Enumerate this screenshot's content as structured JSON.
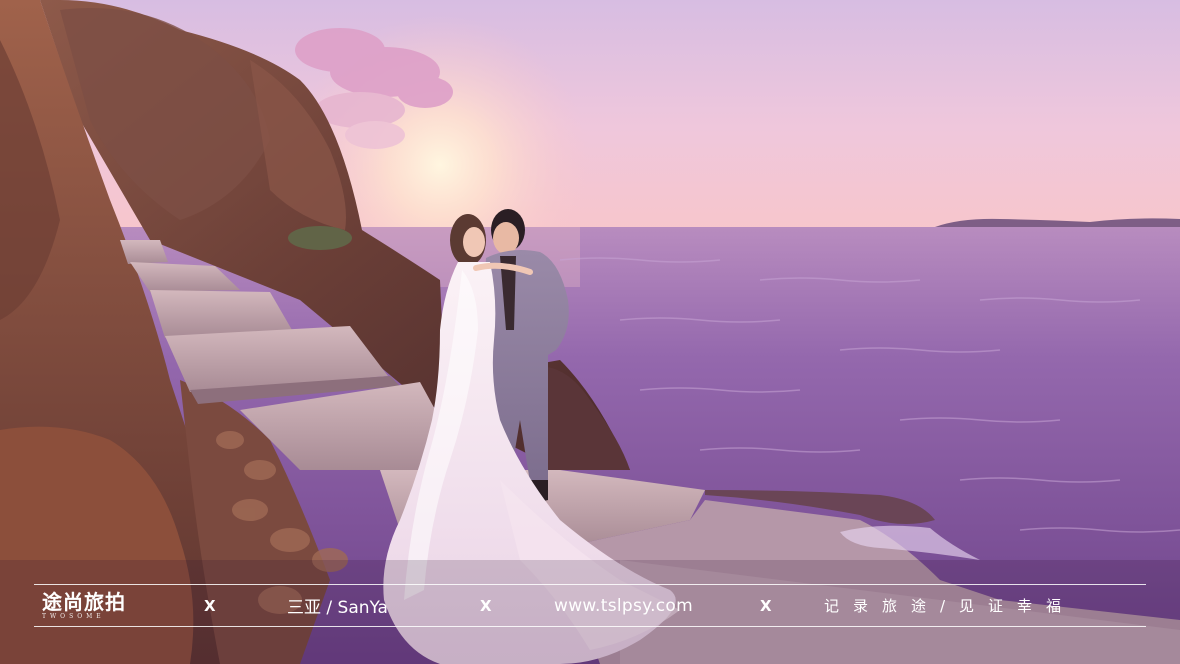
{
  "photo": {
    "subject": "wedding-couple-on-seaside-rocks-at-sunset",
    "colors": {
      "sky_top": "#e2c6e6",
      "sky_horizon": "#f4c2cc",
      "sun": "#fff2d8",
      "sea": "#8c5ea6",
      "rock": "#7a4a3c",
      "stone_steps": "#c7aab0"
    }
  },
  "banner": {
    "logo_cn": "途尚旅拍",
    "logo_en": "TWOSOME",
    "separator": "X",
    "location": "三亚 / SanYa",
    "website": "www.tslpsy.com",
    "slogan": "记录旅途/见证幸福"
  }
}
